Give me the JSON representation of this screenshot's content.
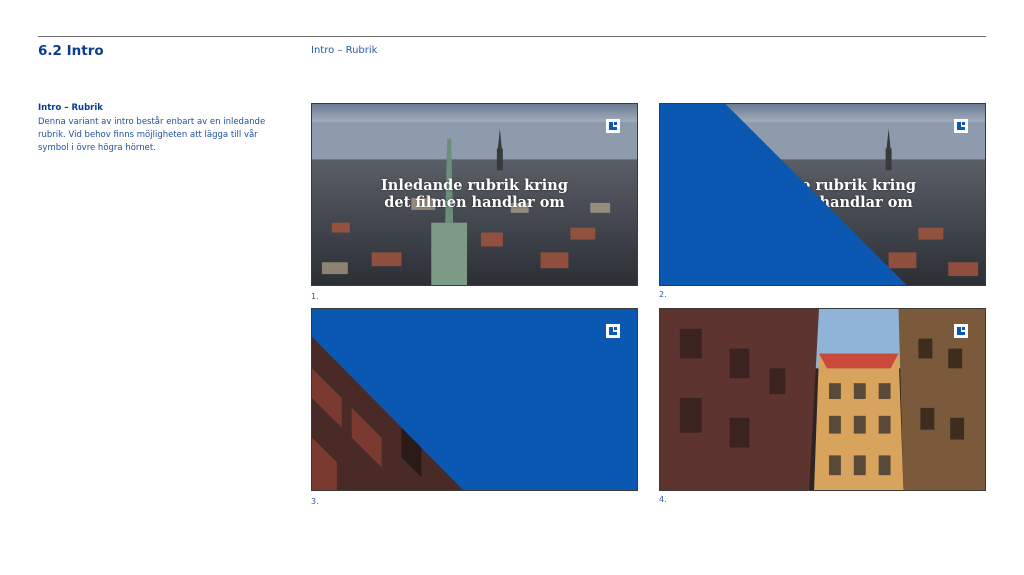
{
  "header": {
    "title": "6.2 Intro",
    "subtitle": "Intro – Rubrik"
  },
  "description": {
    "heading": "Intro – Rubrik",
    "body": "Denna variant av intro består enbart av en inledande rubrik. Vid behov finns möjligheten att lägga till vår symbol i övre högra hörnet."
  },
  "frames": [
    {
      "caption": "1.",
      "overlay_line1": "Inledande rubrik kring",
      "overlay_line2": "det filmen handlar om"
    },
    {
      "caption": "2.",
      "overlay_line1": "Inledande rubrik kring",
      "overlay_line2": "det filmen handlar om"
    },
    {
      "caption": "3."
    },
    {
      "caption": "4."
    }
  ],
  "colors": {
    "brand_blue": "#0b58b3",
    "text_blue": "#0a3d8f"
  },
  "icons": [
    "brand-symbol-icon"
  ]
}
